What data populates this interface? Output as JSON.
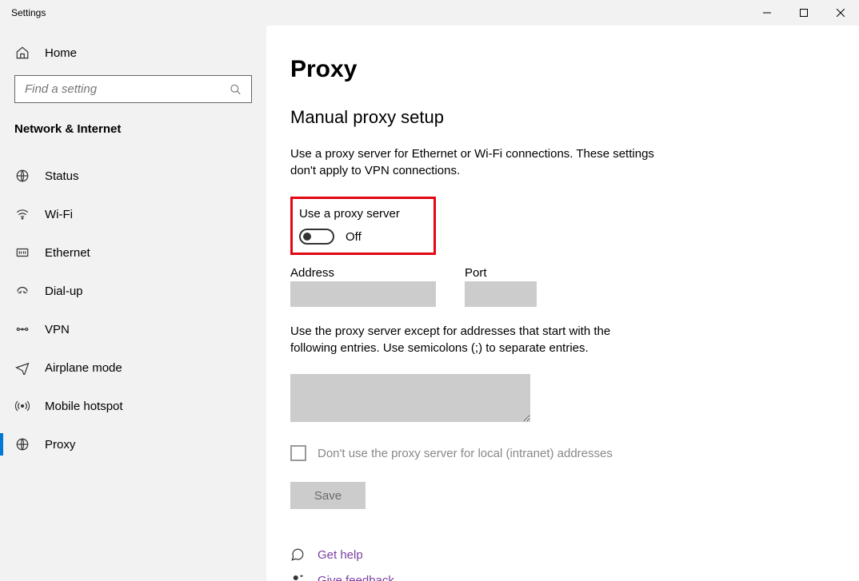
{
  "window": {
    "title": "Settings"
  },
  "sidebar": {
    "home_label": "Home",
    "search_placeholder": "Find a setting",
    "category_heading": "Network & Internet",
    "items": [
      {
        "label": "Status",
        "selected": false
      },
      {
        "label": "Wi-Fi",
        "selected": false
      },
      {
        "label": "Ethernet",
        "selected": false
      },
      {
        "label": "Dial-up",
        "selected": false
      },
      {
        "label": "VPN",
        "selected": false
      },
      {
        "label": "Airplane mode",
        "selected": false
      },
      {
        "label": "Mobile hotspot",
        "selected": false
      },
      {
        "label": "Proxy",
        "selected": true
      }
    ]
  },
  "main": {
    "page_title": "Proxy",
    "section_title": "Manual proxy setup",
    "description": "Use a proxy server for Ethernet or Wi-Fi connections. These settings don't apply to VPN connections.",
    "use_proxy_label": "Use a proxy server",
    "toggle_state_text": "Off",
    "toggle_on": false,
    "address_label": "Address",
    "address_value": "",
    "port_label": "Port",
    "port_value": "",
    "exceptions_text": "Use the proxy server except for addresses that start with the following entries. Use semicolons (;) to separate entries.",
    "exceptions_value": "",
    "local_bypass_label": "Don't use the proxy server for local (intranet) addresses",
    "local_bypass_checked": false,
    "save_label": "Save",
    "help_link": "Get help",
    "feedback_link": "Give feedback"
  }
}
